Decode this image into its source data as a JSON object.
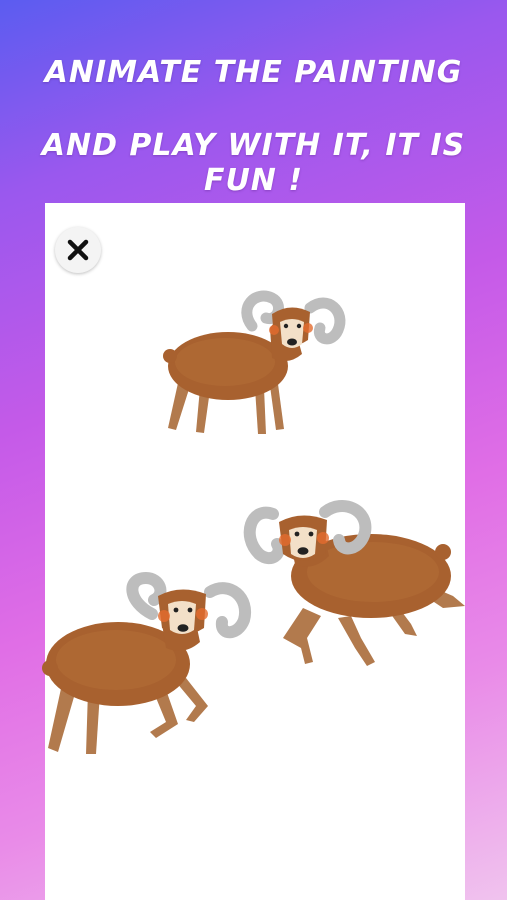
{
  "headline": {
    "line1": "ANIMATE THE PAINTING",
    "line2": "AND PLAY WITH IT, IT IS FUN !"
  },
  "toolbar": {
    "close_icon": "close-icon"
  },
  "colors": {
    "wool": "#a8612f",
    "wool_dark": "#7a4220",
    "horn": "#bdbdbd",
    "legs": "#b27a4d",
    "face": "#f3e0c8",
    "cheek": "#e46b2e"
  }
}
